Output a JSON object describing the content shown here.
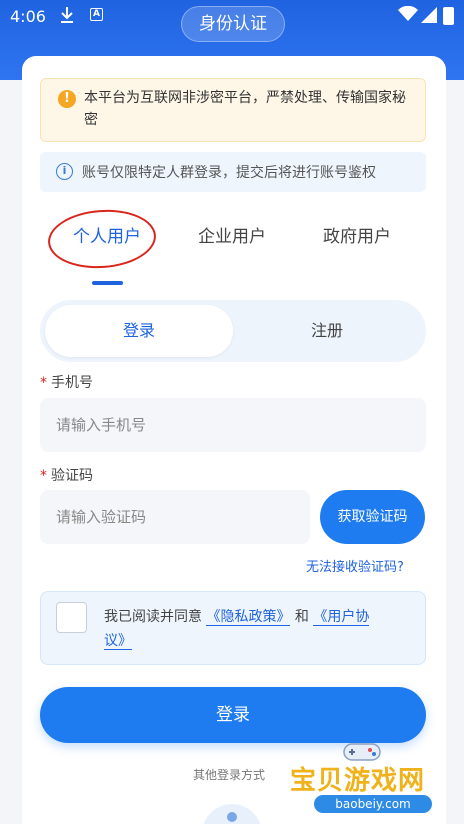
{
  "status_bar": {
    "time": "4:06"
  },
  "header": {
    "title": "身份认证"
  },
  "notices": {
    "warning": "本平台为互联网非涉密平台，严禁处理、传输国家秘密",
    "info": "账号仅限特定人群登录，提交后将进行账号鉴权"
  },
  "user_tabs": [
    {
      "label": "个人用户",
      "active": true
    },
    {
      "label": "企业用户",
      "active": false
    },
    {
      "label": "政府用户",
      "active": false
    }
  ],
  "mode_switch": {
    "login": "登录",
    "register": "注册",
    "active": "login"
  },
  "form": {
    "required_mark": "*",
    "phone_label": "手机号",
    "phone_placeholder": "请输入手机号",
    "code_label": "验证码",
    "code_placeholder": "请输入验证码",
    "get_code_button": "获取验证码",
    "no_code_link": "无法接收验证码?"
  },
  "agreement": {
    "checked": false,
    "prefix": "我已阅读并同意",
    "privacy_link": "《隐私政策》",
    "and": "和",
    "user_agreement_link_part1": "《用户协",
    "user_agreement_link_part2": "议》"
  },
  "login_button": "登录",
  "other_login": "其他登录方式",
  "watermark": {
    "text": "宝贝游戏网",
    "url": "baobeiy.com"
  },
  "colors": {
    "primary": "#1f63e0",
    "button": "#1f7bf0",
    "warning_bg": "#fef7e8",
    "warning_icon": "#f5a623",
    "info_bg": "#eef5fd",
    "annotation_circle": "#d9261c"
  }
}
